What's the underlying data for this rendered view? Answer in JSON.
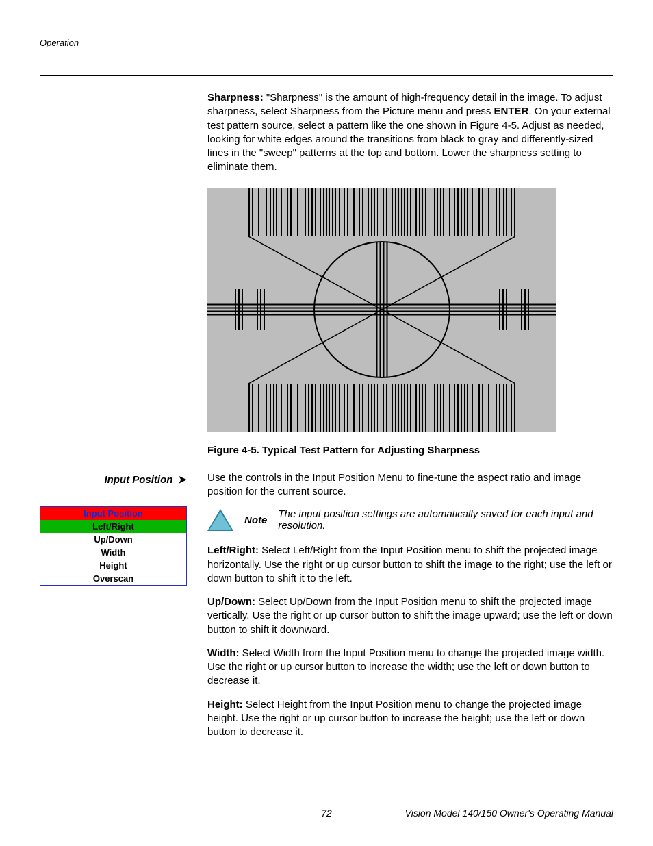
{
  "header": {
    "section": "Operation"
  },
  "sharpness": {
    "label": "Sharpness:",
    "text1": " \"Sharpness\" is the amount of high-frequency detail in the image. To adjust sharpness, select Sharpness from the Picture menu and press ",
    "enter": "ENTER",
    "text2": ". On your external test pattern source, select a pattern like the one shown in Figure 4-5. Adjust as needed, looking for white edges around the transitions from black to gray and differently-sized lines in the \"sweep\" patterns at the top and bottom. Lower the sharpness setting to eliminate them."
  },
  "figure": {
    "caption": "Figure 4-5. Typical Test Pattern for Adjusting Sharpness"
  },
  "sidebar": {
    "heading": "Input Position",
    "arrow": "➤",
    "menu": {
      "title": "Input Position",
      "highlight": "Left/Right",
      "items": [
        "Up/Down",
        "Width",
        "Height",
        "Overscan"
      ]
    }
  },
  "inputPosition": {
    "intro": "Use the controls in the Input Position Menu to fine-tune the aspect ratio and image position for the current source.",
    "noteLabel": "Note",
    "noteText": "The input position settings are automatically saved for each input and resolution.",
    "paras": [
      {
        "label": "Left/Right:",
        "text": " Select Left/Right from the Input Position menu to shift the projected image horizontally. Use the right or up cursor button to shift the image to the right; use the left or down button to shift it to the left."
      },
      {
        "label": "Up/Down:",
        "text": " Select Up/Down from the Input Position menu to shift the projected image vertically. Use the right or up cursor button to shift the image upward; use the left or down button to shift it downward."
      },
      {
        "label": "Width:",
        "text": " Select Width from the Input Position menu to change the projected image width. Use the right or up cursor button to increase the width; use the left or down button to decrease it."
      },
      {
        "label": "Height:",
        "text": " Select Height from the Input Position menu to change the projected image height. Use the right or up cursor button to increase the height; use the left or down button to decrease it."
      }
    ]
  },
  "footer": {
    "page": "72",
    "title": "Vision Model 140/150 Owner's Operating Manual"
  }
}
